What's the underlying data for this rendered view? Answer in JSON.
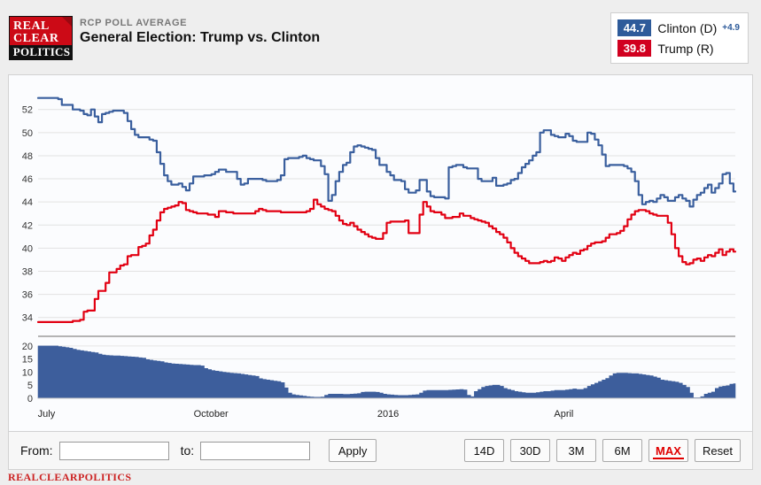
{
  "header": {
    "logo": {
      "line1": "REAL",
      "line2": "CLEAR",
      "line3": "POLITICS"
    },
    "kicker": "RCP POLL AVERAGE",
    "title": "General Election: Trump vs. Clinton"
  },
  "legend": {
    "rows": [
      {
        "value": "44.7",
        "name": "Clinton (D)",
        "delta": "+4.9",
        "color": "#2e5b9a"
      },
      {
        "value": "39.8",
        "name": "Trump (R)",
        "delta": "",
        "color": "#d1001f"
      }
    ]
  },
  "toolbar": {
    "from_label": "From:",
    "from_value": "",
    "from_placeholder": "",
    "to_label": "to:",
    "to_value": "",
    "to_placeholder": "",
    "apply_label": "Apply",
    "ranges": [
      {
        "label": "14D",
        "active": false
      },
      {
        "label": "30D",
        "active": false
      },
      {
        "label": "3M",
        "active": false
      },
      {
        "label": "6M",
        "active": false
      },
      {
        "label": "MAX",
        "active": true
      },
      {
        "label": "Reset",
        "active": false
      }
    ]
  },
  "footer": {
    "text": "REALCLEARPOLITICS"
  },
  "chart_data": {
    "type": "line",
    "title": "General Election: Trump vs. Clinton",
    "subtitle": "RCP POLL AVERAGE",
    "xlabel": "",
    "ylabel": "",
    "ylim": [
      32.6,
      54.2
    ],
    "yticks": [
      34,
      36,
      38,
      40,
      42,
      44,
      46,
      48,
      50,
      52
    ],
    "grid": true,
    "legend_position": "top-right",
    "xtick_labels": [
      "July",
      "October",
      "2016",
      "April"
    ],
    "xtick_positions": [
      0.012,
      0.248,
      0.502,
      0.754
    ],
    "series": [
      {
        "name": "Clinton (D)",
        "color": "#3a5f9e",
        "current": 44.7,
        "values": [
          53.0,
          53.0,
          53.0,
          53.0,
          53.0,
          53.0,
          52.9,
          52.4,
          52.4,
          52.4,
          52.0,
          52.0,
          51.9,
          51.6,
          51.5,
          52.0,
          51.4,
          50.9,
          51.6,
          51.7,
          51.8,
          51.9,
          51.9,
          51.9,
          51.7,
          51.0,
          50.3,
          49.8,
          49.6,
          49.6,
          49.6,
          49.4,
          49.3,
          48.3,
          47.3,
          46.3,
          45.8,
          45.5,
          45.5,
          45.6,
          45.3,
          45.0,
          45.6,
          46.2,
          46.2,
          46.2,
          46.3,
          46.3,
          46.4,
          46.6,
          46.8,
          46.8,
          46.6,
          46.6,
          46.6,
          46.0,
          45.5,
          45.6,
          46.0,
          46.0,
          46.0,
          46.0,
          45.9,
          45.8,
          45.8,
          45.8,
          45.9,
          46.3,
          47.7,
          47.8,
          47.8,
          47.8,
          47.9,
          48.0,
          47.8,
          47.7,
          47.6,
          47.6,
          47.1,
          46.4,
          44.1,
          44.6,
          45.8,
          46.6,
          47.2,
          47.4,
          48.3,
          48.8,
          48.9,
          48.8,
          48.7,
          48.6,
          48.5,
          47.8,
          47.2,
          47.2,
          46.6,
          46.3,
          45.9,
          45.9,
          45.8,
          45.1,
          44.8,
          44.8,
          45.0,
          45.9,
          45.9,
          44.9,
          44.5,
          44.4,
          44.4,
          44.4,
          44.3,
          47.0,
          47.1,
          47.2,
          47.2,
          47.0,
          46.9,
          46.9,
          46.9,
          46.0,
          45.8,
          45.8,
          45.8,
          46.1,
          45.4,
          45.4,
          45.5,
          45.6,
          45.9,
          46.0,
          46.5,
          47.0,
          47.3,
          47.6,
          48.0,
          48.3,
          50.0,
          50.2,
          50.2,
          49.8,
          49.7,
          49.6,
          49.6,
          49.9,
          49.7,
          49.3,
          49.2,
          49.2,
          49.2,
          50.0,
          49.9,
          49.4,
          48.9,
          48.1,
          47.1,
          47.2,
          47.2,
          47.2,
          47.2,
          47.1,
          46.9,
          46.6,
          45.8,
          44.6,
          43.8,
          44.0,
          44.1,
          44.0,
          44.3,
          44.6,
          44.4,
          44.1,
          44.1,
          44.4,
          44.6,
          44.3,
          44.1,
          43.6,
          44.2,
          44.6,
          44.8,
          45.2,
          45.5,
          44.8,
          45.2,
          45.6,
          46.4,
          46.5,
          45.6,
          44.9
        ]
      },
      {
        "name": "Trump (R)",
        "color": "#e20012",
        "current": 39.8,
        "values": [
          33.6,
          33.6,
          33.6,
          33.6,
          33.6,
          33.6,
          33.6,
          33.6,
          33.6,
          33.6,
          33.7,
          33.7,
          33.8,
          34.5,
          34.6,
          34.6,
          35.6,
          36.3,
          36.3,
          37.0,
          37.9,
          37.9,
          38.2,
          38.5,
          38.6,
          39.3,
          39.4,
          39.4,
          40.1,
          40.2,
          40.4,
          41.1,
          41.6,
          42.4,
          43.1,
          43.4,
          43.5,
          43.6,
          43.7,
          44.0,
          43.9,
          43.3,
          43.2,
          43.1,
          43.0,
          43.0,
          43.0,
          42.9,
          42.9,
          42.7,
          43.2,
          43.2,
          43.1,
          43.1,
          43.0,
          43.0,
          43.0,
          43.0,
          43.0,
          43.0,
          43.2,
          43.4,
          43.3,
          43.2,
          43.2,
          43.2,
          43.2,
          43.1,
          43.1,
          43.1,
          43.1,
          43.1,
          43.1,
          43.1,
          43.2,
          43.4,
          44.2,
          43.8,
          43.6,
          43.4,
          43.3,
          43.2,
          42.8,
          42.4,
          42.1,
          42.0,
          42.2,
          41.9,
          41.6,
          41.4,
          41.2,
          41.0,
          40.9,
          40.8,
          40.8,
          41.3,
          42.2,
          42.3,
          42.3,
          42.3,
          42.3,
          42.4,
          41.3,
          41.3,
          41.3,
          42.9,
          44.0,
          43.6,
          43.2,
          43.1,
          43.1,
          42.9,
          42.6,
          42.6,
          42.7,
          42.7,
          43.0,
          42.8,
          42.8,
          42.6,
          42.5,
          42.4,
          42.3,
          42.2,
          41.9,
          41.7,
          41.4,
          41.2,
          40.9,
          40.5,
          40.0,
          39.6,
          39.3,
          39.1,
          38.9,
          38.7,
          38.7,
          38.7,
          38.8,
          38.9,
          38.8,
          38.9,
          39.2,
          39.1,
          38.9,
          39.2,
          39.4,
          39.6,
          39.5,
          39.8,
          39.9,
          40.2,
          40.4,
          40.5,
          40.5,
          40.6,
          40.9,
          41.2,
          41.2,
          41.3,
          41.5,
          41.9,
          42.5,
          42.9,
          43.2,
          43.3,
          43.3,
          43.2,
          43.0,
          42.9,
          42.8,
          42.8,
          42.8,
          42.2,
          41.2,
          40.0,
          39.3,
          38.8,
          38.6,
          38.7,
          39.0,
          39.1,
          38.9,
          39.2,
          39.4,
          39.3,
          39.6,
          39.9,
          39.4,
          39.7,
          39.9,
          39.7
        ]
      }
    ],
    "volume_panel": {
      "type": "area",
      "color": "#3d5e9c",
      "yticks": [
        0,
        5,
        10,
        15,
        20
      ],
      "ylim": [
        0,
        22
      ],
      "values": [
        20.0,
        20.0,
        20.0,
        20.0,
        20.0,
        20.0,
        19.8,
        19.6,
        19.4,
        19.2,
        18.8,
        18.4,
        18.2,
        18.0,
        17.8,
        17.6,
        17.4,
        16.9,
        16.6,
        16.4,
        16.3,
        16.2,
        16.2,
        16.1,
        16.0,
        15.9,
        15.8,
        15.7,
        15.5,
        15.4,
        14.8,
        14.6,
        14.4,
        14.2,
        14.0,
        13.6,
        13.4,
        13.2,
        13.1,
        13.0,
        12.9,
        12.8,
        12.7,
        12.6,
        12.6,
        12.4,
        11.4,
        11.0,
        10.6,
        10.4,
        10.2,
        10.0,
        9.8,
        9.6,
        9.5,
        9.4,
        9.2,
        9.0,
        8.8,
        8.6,
        8.4,
        7.5,
        7.2,
        7.0,
        6.8,
        6.6,
        6.4,
        6.0,
        4.0,
        2.0,
        1.4,
        1.2,
        1.0,
        0.8,
        0.6,
        0.5,
        0.4,
        0.4,
        0.5,
        1.2,
        1.6,
        1.6,
        1.6,
        1.6,
        1.5,
        1.5,
        1.6,
        1.7,
        1.8,
        2.3,
        2.4,
        2.4,
        2.4,
        2.3,
        2.0,
        1.6,
        1.4,
        1.3,
        1.2,
        1.1,
        1.1,
        1.1,
        1.2,
        1.3,
        1.4,
        2.0,
        2.8,
        3.0,
        3.0,
        3.0,
        3.0,
        3.0,
        3.0,
        3.1,
        3.2,
        3.3,
        3.4,
        3.2,
        1.2,
        0.6,
        2.6,
        3.4,
        4.2,
        4.6,
        4.8,
        5.0,
        5.0,
        4.6,
        3.8,
        3.4,
        3.0,
        2.6,
        2.4,
        2.2,
        2.0,
        2.0,
        2.0,
        2.2,
        2.4,
        2.6,
        2.6,
        2.8,
        3.0,
        3.0,
        3.0,
        3.2,
        3.4,
        3.6,
        3.4,
        3.4,
        3.8,
        4.6,
        5.2,
        5.8,
        6.4,
        7.0,
        7.6,
        8.6,
        9.4,
        9.6,
        9.6,
        9.6,
        9.5,
        9.4,
        9.4,
        9.2,
        9.0,
        8.8,
        8.6,
        8.2,
        7.8,
        7.0,
        6.8,
        6.6,
        6.4,
        6.2,
        5.8,
        5.0,
        4.2,
        2.0,
        0.2,
        0.2,
        0.6,
        1.6,
        2.0,
        2.4,
        3.8,
        4.4,
        4.6,
        4.8,
        5.4,
        5.6
      ]
    }
  }
}
